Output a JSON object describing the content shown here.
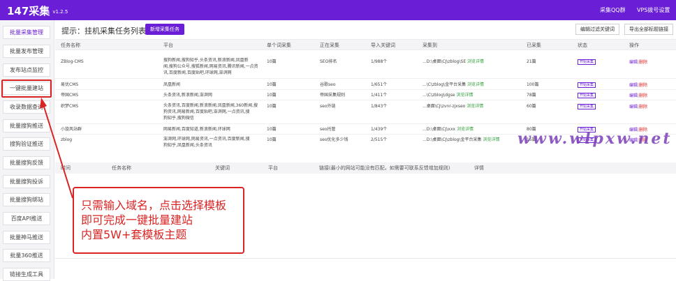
{
  "header": {
    "brand": "147采集",
    "version": "v1.2.5",
    "links": [
      "采集QQ群",
      "VPS拨号设置"
    ]
  },
  "sidebar": {
    "items": [
      "批量采集管理",
      "批量发布管理",
      "发布站点监控",
      "一键批量建站",
      "收录数据查询",
      "批量搜狗推送",
      "搜狗验证推送",
      "批量搜狗反馈",
      "批量搜狗投诉",
      "批量搜狗绑站",
      "百度API推送",
      "批量神马推送",
      "批量360推送",
      "链接生成工具"
    ],
    "active_index": 0,
    "highlighted_index": 3
  },
  "toolbar": {
    "hint": "提示：挂机采集任务列表",
    "new_task": "新增采集任务",
    "filter_keywords": "编辑过滤关键词",
    "export_all": "导出全部标题链接"
  },
  "task_table": {
    "columns": [
      "任务名称",
      "平台",
      "单个词采集",
      "正在采集",
      "导入关键词",
      "采集到",
      "已采集",
      "状态",
      "操作"
    ],
    "rows": [
      {
        "name": "ZBlog-CMS",
        "platform": [
          "搜狗新闻,搜狗知乎,头条资讯,新浪新闻,凤凰新",
          "闻,搜狗公众号,搜狐新闻,网易资讯,腾讯新闻,一点资",
          "讯,百度新闻,百度贴吧,环球网,澎湃网"
        ],
        "per_word": "10篇",
        "collecting": "SEO排名",
        "imported": "1/988个",
        "dest": "...D:\\桌面\\CJ\\zblog\\SE",
        "dest_link": "浏览详情",
        "done": "21篇",
        "status": "开始采集",
        "edit": "编辑",
        "del": "删除"
      },
      {
        "name": "易优CMS",
        "platform": [
          "凤凰新闻"
        ],
        "per_word": "10篇",
        "collecting": "谷歌seo",
        "imported": "1/651个",
        "dest": "...\\C\\zblog\\金平台采集",
        "dest_link": "浏览详情",
        "done": "100篇",
        "status": "开始采集",
        "edit": "编辑",
        "del": "删除"
      },
      {
        "name": "帝国CMS",
        "platform": [
          "头条资讯,新浪新闻,澎湃网"
        ],
        "per_word": "10篇",
        "collecting": "帝国采集规则",
        "imported": "1/411个",
        "dest": "...\\C\\zblog\\dgse",
        "dest_link": "浏览详情",
        "done": "78篇",
        "status": "开始采集",
        "edit": "编辑",
        "del": "删除"
      },
      {
        "name": "织梦CMS",
        "platform": [
          "头条资讯,百度新闻,新浪新闻,凤凰新闻,360新闻,搜",
          "狗资讯,网易新闻,百度贴吧,澎湃网,一点资讯,搜",
          "狗知乎,搜狗微信"
        ],
        "per_word": "10篇",
        "collecting": "seo外链",
        "imported": "1/843个",
        "dest": "...桌面\\CJ\\zvnr-zjxseo",
        "dest_link": "浏览详情",
        "done": "60篇",
        "status": "开始采集",
        "edit": "编辑",
        "del": "删除"
      },
      {
        "name": "小旋风站群",
        "platform": [
          "网易新闻,百度知道,新浪新闻,环球网"
        ],
        "per_word": "10篇",
        "collecting": "seo托管",
        "imported": "1/439个",
        "dest": "...D:\\桌面\\CJ\\xxx",
        "dest_link": "浏览详情",
        "done": "80篇",
        "status": "开始采集",
        "edit": "编辑",
        "del": "删除"
      },
      {
        "name": "zblog",
        "platform": [
          "澎湃网,环球网,网易资讯,一点资讯,百度新闻,搜",
          "狗知乎,凤凰新闻,头条资讯"
        ],
        "per_word": "10篇",
        "collecting": "seo优化多少钱",
        "imported": "2/515个",
        "dest": "...D:\\桌面\\CJ\\zblog\\金平台采集",
        "dest_link": "浏览详情",
        "done": "15篇",
        "status": "开始采集",
        "edit": "编辑",
        "del": "删除"
      }
    ]
  },
  "log_table": {
    "columns": [
      "时间",
      "任务名称",
      "关键词",
      "平台",
      "链接(最小的网站可能没有匹配，如需要可联系反馈增加规则)",
      "详情"
    ]
  },
  "watermark": "www.wlpxw.net",
  "callout": {
    "lines": [
      "只需输入域名，点击选择模板",
      "即可完成一键批量建站",
      "内置5W+套模板主题"
    ],
    "color": "#d92424"
  },
  "colors": {
    "accent": "#6a1fd6",
    "highlight": "#d92424",
    "link_green": "#2e9c3a"
  }
}
